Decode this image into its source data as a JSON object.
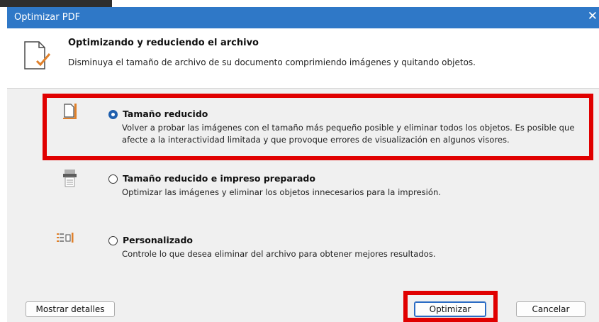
{
  "window": {
    "title": "Optimizar PDF",
    "close_glyph": "✕"
  },
  "header": {
    "icon": "document-check-icon",
    "heading": "Optimizando y reduciendo el archivo",
    "description": "Disminuya el tamaño de archivo de su documento comprimiendo imágenes y quitando objetos."
  },
  "options": [
    {
      "icon": "reduced-size-icon",
      "label": "Tamaño reducido",
      "description": "Volver a probar las imágenes con el tamaño más pequeño posible y eliminar todos los objetos. Es posible que afecte a la interactividad limitada y que provoque errores de visualización en algunos visores.",
      "selected": true
    },
    {
      "icon": "printer-icon",
      "label": "Tamaño reducido e impreso preparado",
      "description": "Optimizar las imágenes y eliminar los objetos innecesarios para la impresión.",
      "selected": false
    },
    {
      "icon": "custom-list-icon",
      "label": "Personalizado",
      "description": "Controle lo que desea eliminar del archivo para obtener mejores resultados.",
      "selected": false
    }
  ],
  "footer": {
    "details_label": "Mostrar detalles",
    "optimize_label": "Optimizar",
    "cancel_label": "Cancelar"
  },
  "colors": {
    "titlebar": "#2f78c7",
    "accent_icon": "#e0802a",
    "highlight": "#e00000",
    "radio_checked": "#1f5fae"
  }
}
